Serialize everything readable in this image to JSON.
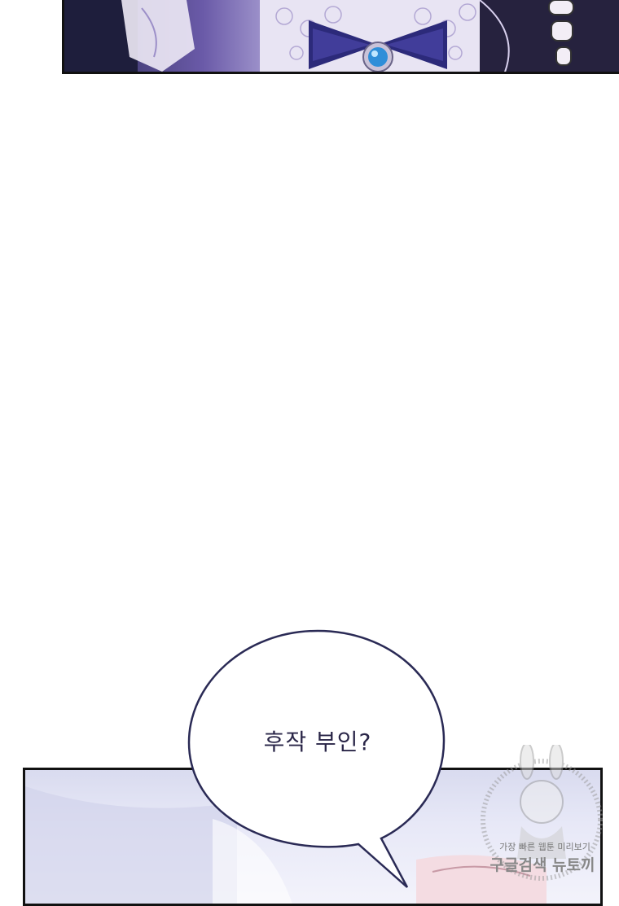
{
  "speech_bubble": {
    "text": "후작 부인?"
  },
  "watermark": {
    "line1": "가장 빠른 웹툰 미리보기",
    "line2": "구글검색 뉴토끼"
  }
}
